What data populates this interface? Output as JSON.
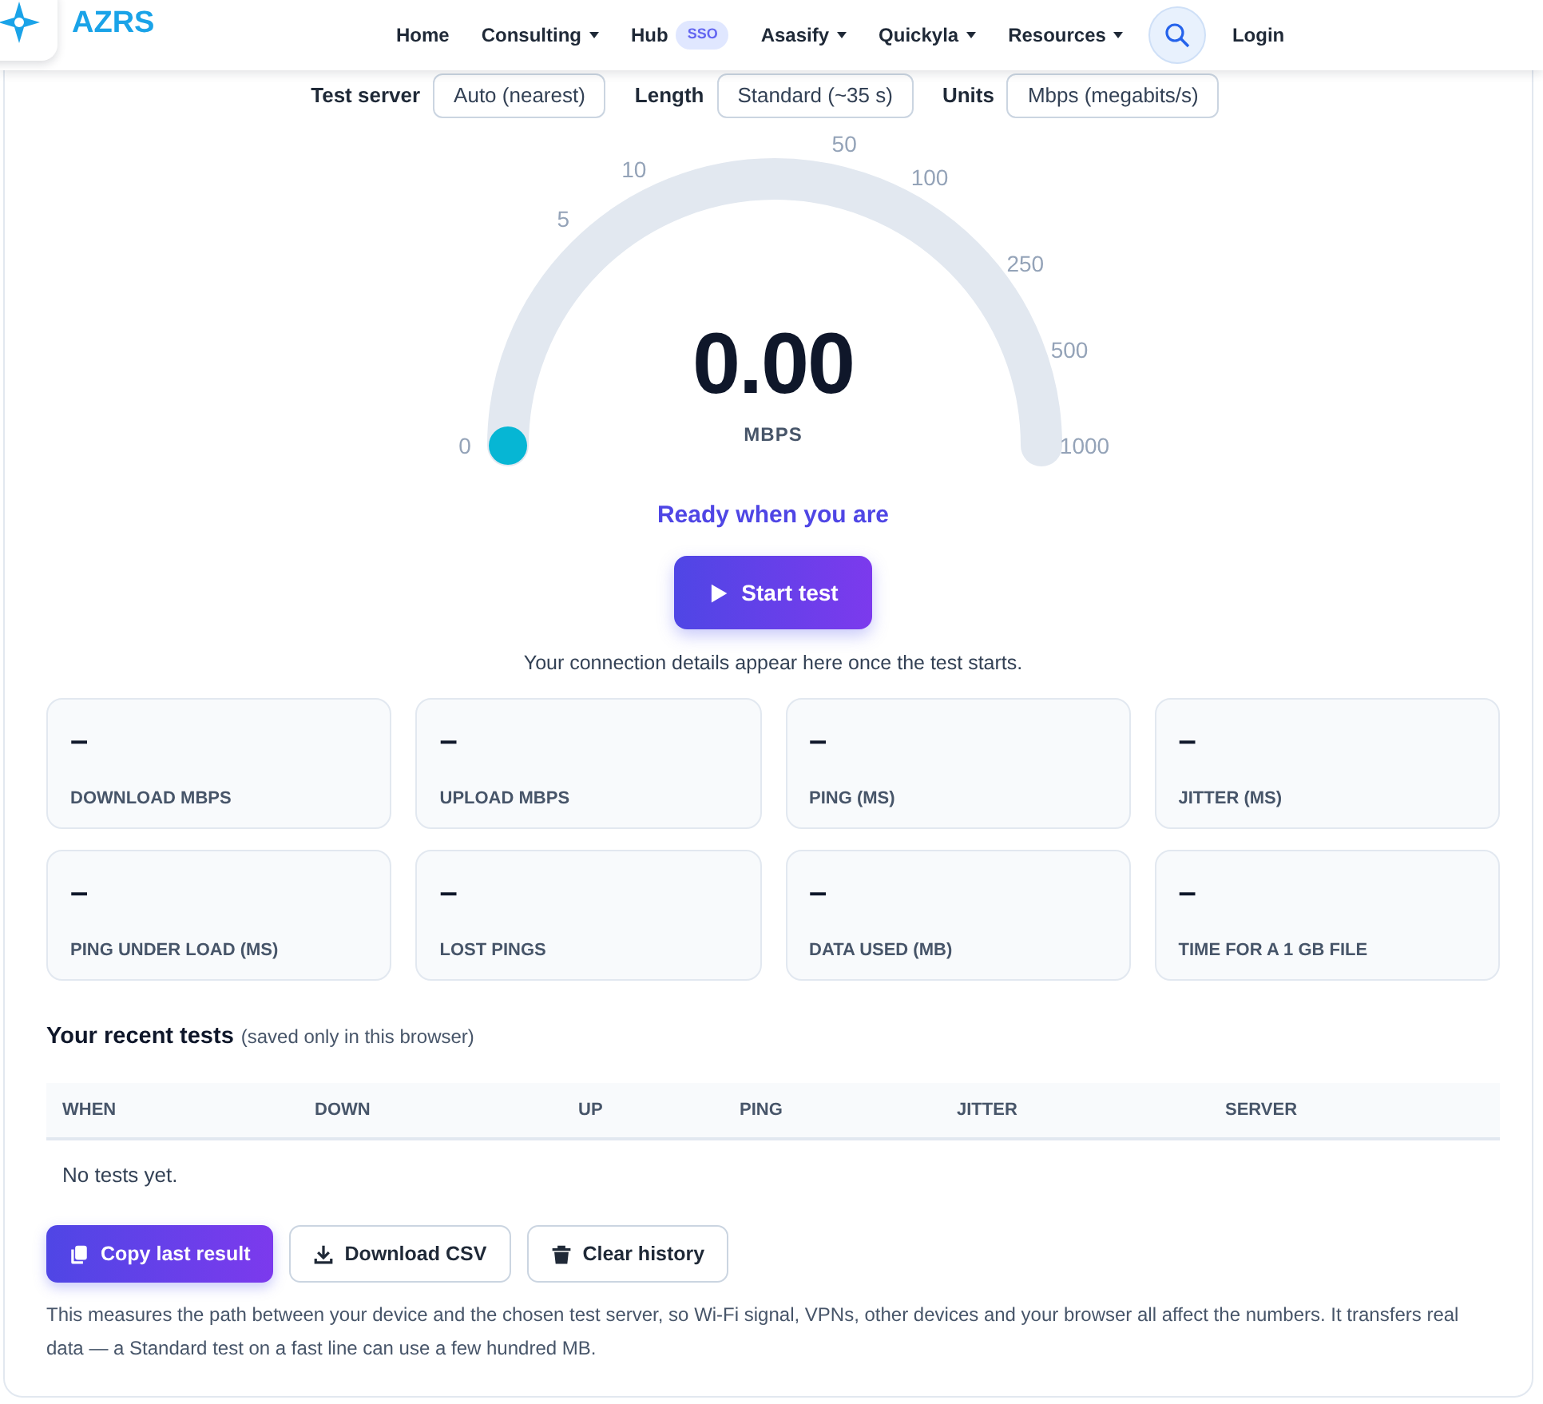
{
  "navbar": {
    "brand": "AZRS",
    "items": [
      {
        "label": "Home",
        "dropdown": false
      },
      {
        "label": "Consulting",
        "dropdown": true
      },
      {
        "label": "Hub",
        "badge": "SSO",
        "dropdown": false
      },
      {
        "label": "Asasify",
        "dropdown": true
      },
      {
        "label": "Quickyla",
        "dropdown": true
      },
      {
        "label": "Resources",
        "dropdown": true
      }
    ],
    "login": "Login"
  },
  "settings": [
    {
      "label": "Test server",
      "value": "Auto (nearest)"
    },
    {
      "label": "Length",
      "value": "Standard (~35 s)"
    },
    {
      "label": "Units",
      "value": "Mbps (megabits/s)"
    }
  ],
  "gauge": {
    "ticks": [
      "0",
      "5",
      "10",
      "50",
      "100",
      "250",
      "500",
      "1000"
    ],
    "value": "0.00",
    "unit": "MBPS",
    "level": 0
  },
  "status": "Ready when you are",
  "start_button": "Start test",
  "hint": "Your connection details appear here once the test starts.",
  "stats": [
    {
      "value": "–",
      "label": "DOWNLOAD MBPS"
    },
    {
      "value": "–",
      "label": "UPLOAD MBPS"
    },
    {
      "value": "–",
      "label": "PING (MS)"
    },
    {
      "value": "–",
      "label": "JITTER (MS)"
    },
    {
      "value": "–",
      "label": "PING UNDER LOAD (MS)"
    },
    {
      "value": "–",
      "label": "LOST PINGS"
    },
    {
      "value": "–",
      "label": "DATA USED (MB)"
    },
    {
      "value": "–",
      "label": "TIME FOR A 1 GB FILE"
    }
  ],
  "recent": {
    "title": "Your recent tests",
    "note": "(saved only in this browser)",
    "columns": [
      "WHEN",
      "DOWN",
      "UP",
      "PING",
      "JITTER",
      "SERVER"
    ],
    "empty": "No tests yet."
  },
  "actions": [
    {
      "label": "Copy last result",
      "kind": "primary"
    },
    {
      "label": "Download CSV",
      "kind": "outline"
    },
    {
      "label": "Clear history",
      "kind": "outline"
    }
  ],
  "footnote": "This measures the path between your device and the chosen test server, so Wi-Fi signal, VPNs, other devices and your browser all affect the numbers. It transfers real data — a Standard test on a fast line can use a few hundred MB."
}
